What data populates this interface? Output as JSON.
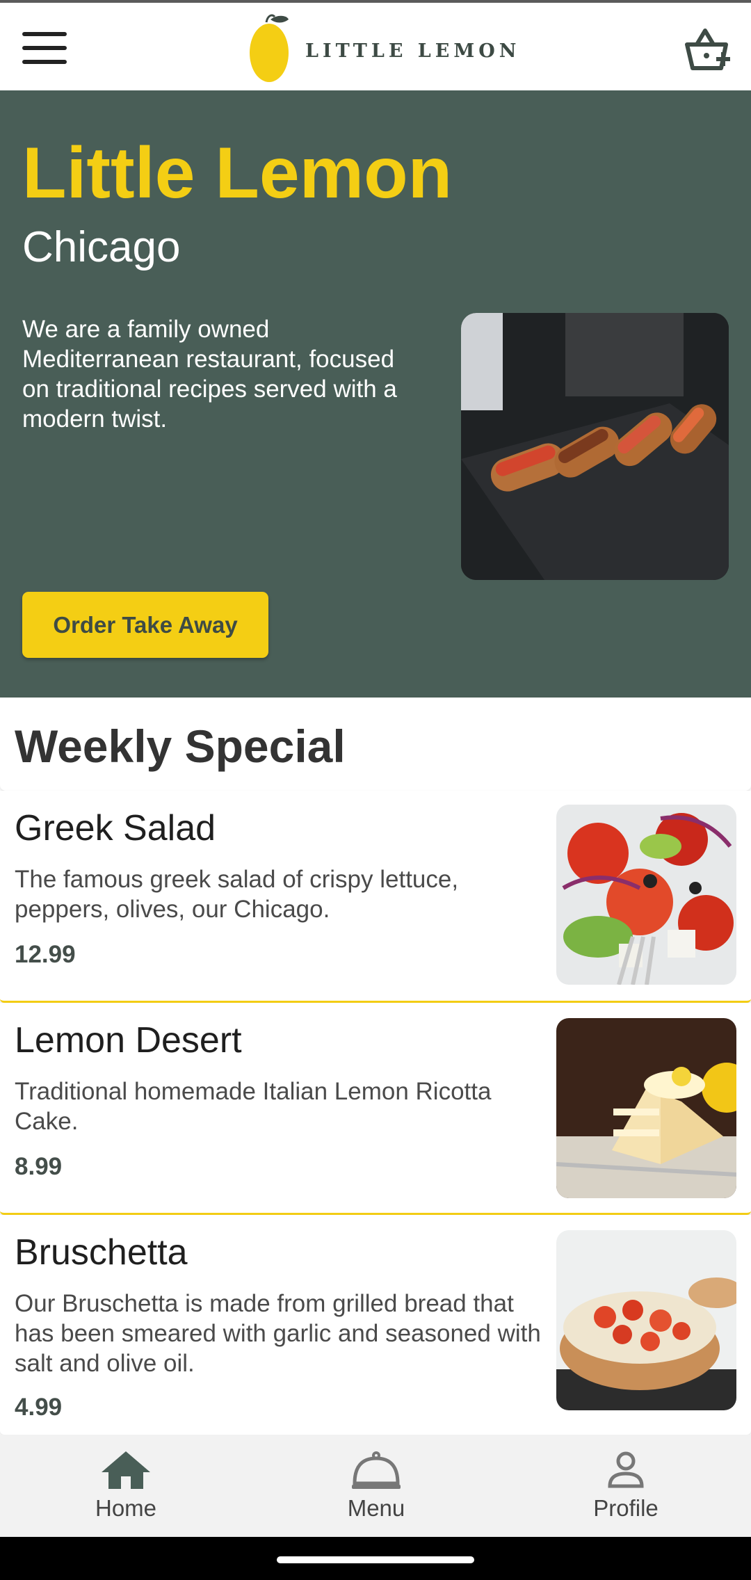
{
  "header": {
    "brand": "LITTLE LEMON",
    "menu_icon": "hamburger-icon",
    "cart_icon": "basket-add-icon"
  },
  "hero": {
    "title": "Little Lemon",
    "subtitle": "Chicago",
    "description": "We are a family owned Mediterranean restaurant, focused on traditional recipes served with a modern twist.",
    "button": "Order Take Away",
    "image": "bruschetta-platter-photo"
  },
  "weekly": {
    "title": "Weekly Special"
  },
  "menu": [
    {
      "name": "Greek Salad",
      "description": "The famous greek salad of crispy lettuce, peppers, olives, our Chicago.",
      "price": "12.99",
      "image": "greek-salad-photo"
    },
    {
      "name": "Lemon Desert",
      "description": "Traditional homemade Italian Lemon Ricotta Cake.",
      "price": "8.99",
      "image": "lemon-cake-photo"
    },
    {
      "name": "Bruschetta",
      "description": "Our Bruschetta is made from grilled bread that has been smeared with garlic and seasoned with salt and olive oil.",
      "price": "4.99",
      "image": "bruschetta-photo"
    }
  ],
  "nav": {
    "items": [
      {
        "label": "Home",
        "icon": "home-icon"
      },
      {
        "label": "Menu",
        "icon": "cloche-icon"
      },
      {
        "label": "Profile",
        "icon": "person-icon"
      }
    ]
  },
  "colors": {
    "primary_green": "#495e57",
    "primary_yellow": "#f4ce14",
    "nav_background": "#f2f2f2"
  }
}
